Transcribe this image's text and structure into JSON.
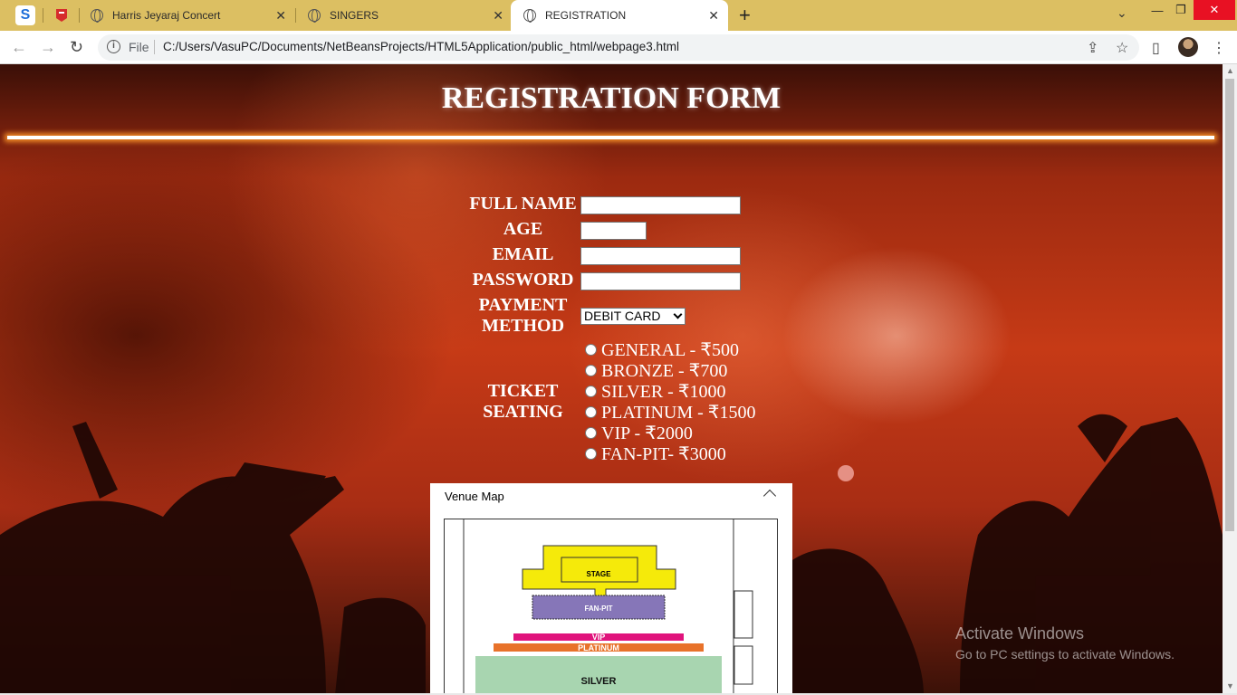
{
  "browser": {
    "tabs": [
      {
        "title": "Harris Jeyaraj Concert"
      },
      {
        "title": "SINGERS"
      },
      {
        "title": "REGISTRATION"
      }
    ],
    "address": {
      "scheme_label": "File",
      "url": "C:/Users/VasuPC/Documents/NetBeansProjects/HTML5Application/public_html/webpage3.html"
    }
  },
  "form": {
    "title": "REGISTRATION FORM",
    "labels": {
      "full_name": "FULL NAME",
      "age": "AGE",
      "email": "EMAIL",
      "password": "PASSWORD",
      "payment_line1": "PAYMENT",
      "payment_line2": "METHOD",
      "ticket_line1": "TICKET",
      "ticket_line2": "SEATING"
    },
    "payment_selected": "DEBIT CARD",
    "ticket_options": [
      "GENERAL - ₹500",
      "BRONZE - ₹700",
      "SILVER - ₹1000",
      "PLATINUM - ₹1500",
      "VIP - ₹2000",
      "FAN-PIT- ₹3000"
    ]
  },
  "venue_map": {
    "heading": "Venue Map",
    "zones": [
      "STAGE",
      "FAN-PIT",
      "VIP",
      "PLATINUM",
      "SILVER"
    ],
    "zone_colors": {
      "stage": "#f5ea0a",
      "fanpit": "#8676b8",
      "vip": "#e0137c",
      "platinum": "#e8722a",
      "silver": "#a8d5b0"
    }
  },
  "watermark": {
    "line1": "Activate Windows",
    "line2": "Go to PC settings to activate Windows."
  }
}
